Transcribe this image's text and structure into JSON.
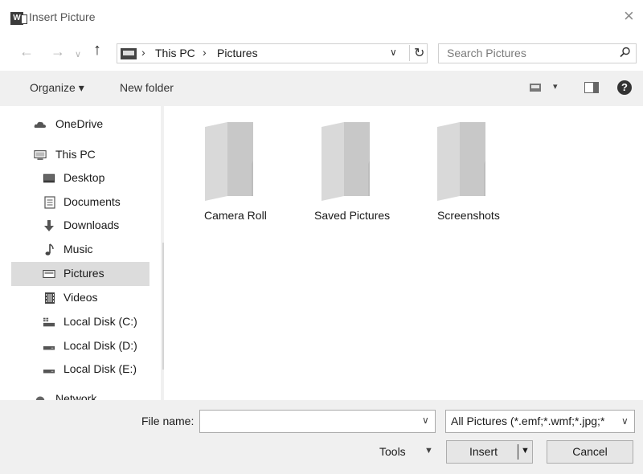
{
  "window": {
    "title": "Insert Picture",
    "app_icon": "word-icon",
    "close": "×"
  },
  "address": {
    "back": "←",
    "forward": "→",
    "recent": "∨",
    "up": "↑",
    "separator": "›",
    "segments": [
      "This PC",
      "Pictures"
    ],
    "dropdown": "∨",
    "refresh": "↻"
  },
  "search": {
    "placeholder": "Search Pictures"
  },
  "toolbar": {
    "organize": "Organize ▾",
    "new_folder": "New folder",
    "view_dropdown": "▾",
    "help": "?"
  },
  "nav": {
    "items": [
      {
        "label": "OneDrive",
        "icon": "cloud-icon"
      },
      {
        "label": "This PC",
        "icon": "computer-icon"
      },
      {
        "label": "Desktop",
        "icon": "desktop-icon"
      },
      {
        "label": "Documents",
        "icon": "document-icon"
      },
      {
        "label": "Downloads",
        "icon": "download-icon"
      },
      {
        "label": "Music",
        "icon": "music-icon"
      },
      {
        "label": "Pictures",
        "icon": "pictures-icon",
        "selected": true
      },
      {
        "label": "Videos",
        "icon": "video-icon"
      },
      {
        "label": "Local Disk (C:)",
        "icon": "drive-c-icon"
      },
      {
        "label": "Local Disk (D:)",
        "icon": "drive-icon"
      },
      {
        "label": "Local Disk (E:)",
        "icon": "drive-icon"
      },
      {
        "label": "Network",
        "icon": "network-icon"
      }
    ],
    "scroll_up": "^",
    "scroll_down": "v"
  },
  "folders": [
    {
      "label": "Camera Roll"
    },
    {
      "label": "Saved Pictures"
    },
    {
      "label": "Screenshots"
    }
  ],
  "bottom": {
    "file_name_label": "File name:",
    "file_name_value": "",
    "file_name_dropdown": "∨",
    "file_type": "All Pictures (*.emf;*.wmf;*.jpg;*",
    "file_type_dropdown": "∨",
    "tools": "Tools",
    "tools_dropdown": "▼",
    "insert": "Insert",
    "insert_dropdown": "▼",
    "cancel": "Cancel"
  }
}
